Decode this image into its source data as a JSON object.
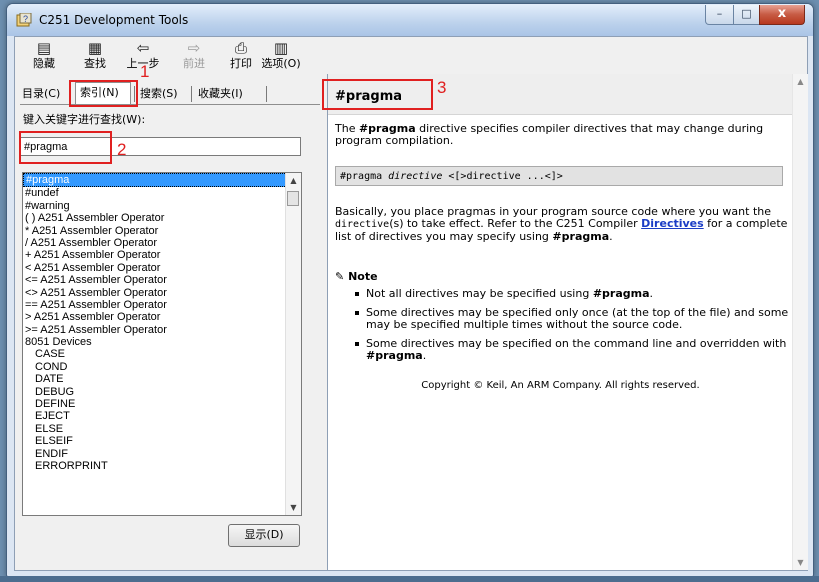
{
  "window": {
    "title": "C251 Development Tools",
    "controls": {
      "minimize": "–",
      "maximize": "□",
      "close": "x"
    }
  },
  "toolbar": [
    {
      "id": "hide",
      "label": "隐藏",
      "icon": "hide-icon",
      "glyph": "▤"
    },
    {
      "id": "find",
      "label": "查找",
      "icon": "find-icon",
      "glyph": "▦"
    },
    {
      "id": "back",
      "label": "上一步",
      "icon": "back-arrow-icon",
      "glyph": "⇦"
    },
    {
      "id": "forward",
      "label": "前进",
      "icon": "forward-arrow-icon",
      "glyph": "⇨"
    },
    {
      "id": "print",
      "label": "打印",
      "icon": "print-icon",
      "glyph": "⎙"
    },
    {
      "id": "options",
      "label": "选项(O)",
      "icon": "options-icon",
      "glyph": "▥"
    }
  ],
  "tabs": [
    {
      "label": "目录(C)",
      "active": false
    },
    {
      "label": "索引(N)",
      "active": true
    },
    {
      "label": "搜索(S)",
      "active": false
    },
    {
      "label": "收藏夹(I)",
      "active": false
    }
  ],
  "index": {
    "prompt": "键入关键字进行查找(W):",
    "keyword": "#pragma",
    "items": [
      {
        "text": "#pragma",
        "selected": true,
        "sub": false
      },
      {
        "text": "#undef",
        "selected": false,
        "sub": false
      },
      {
        "text": "#warning",
        "selected": false,
        "sub": false
      },
      {
        "text": "( ) A251 Assembler Operator",
        "selected": false,
        "sub": false
      },
      {
        "text": "* A251 Assembler Operator",
        "selected": false,
        "sub": false
      },
      {
        "text": "/ A251 Assembler Operator",
        "selected": false,
        "sub": false
      },
      {
        "text": "+ A251 Assembler Operator",
        "selected": false,
        "sub": false
      },
      {
        "text": "< A251 Assembler Operator",
        "selected": false,
        "sub": false
      },
      {
        "text": "<= A251 Assembler Operator",
        "selected": false,
        "sub": false
      },
      {
        "text": "<> A251 Assembler Operator",
        "selected": false,
        "sub": false
      },
      {
        "text": "== A251 Assembler Operator",
        "selected": false,
        "sub": false
      },
      {
        "text": "> A251 Assembler Operator",
        "selected": false,
        "sub": false
      },
      {
        "text": ">= A251 Assembler Operator",
        "selected": false,
        "sub": false
      },
      {
        "text": "8051 Devices",
        "selected": false,
        "sub": false
      },
      {
        "text": "CASE",
        "selected": false,
        "sub": true
      },
      {
        "text": "COND",
        "selected": false,
        "sub": true
      },
      {
        "text": "DATE",
        "selected": false,
        "sub": true
      },
      {
        "text": "DEBUG",
        "selected": false,
        "sub": true
      },
      {
        "text": "DEFINE",
        "selected": false,
        "sub": true
      },
      {
        "text": "EJECT",
        "selected": false,
        "sub": true
      },
      {
        "text": "ELSE",
        "selected": false,
        "sub": true
      },
      {
        "text": "ELSEIF",
        "selected": false,
        "sub": true
      },
      {
        "text": "ENDIF",
        "selected": false,
        "sub": true
      },
      {
        "text": "ERRORPRINT",
        "selected": false,
        "sub": true
      }
    ],
    "display_button": "显示(D)"
  },
  "topic": {
    "title": "#pragma",
    "intro_pre": "The ",
    "intro_bold": "#pragma",
    "intro_post": " directive specifies compiler directives that may change during program compilation.",
    "syntax_pre": "#pragma ",
    "syntax_italic": "directive",
    "syntax_post": " <[>directive ...<]>",
    "body_1": "Basically, you place pragmas in your program source code where you want the ",
    "body_code": "directive",
    "body_2": "(s) to take effect. Refer to the C251 Compiler ",
    "body_link": "Directives",
    "body_3": " for a complete list of directives you may specify using ",
    "body_bold": "#pragma",
    "body_4": ".",
    "note_title": "Note",
    "notes": [
      {
        "pre": "Not all directives may be specified using ",
        "bold": "#pragma",
        "post": "."
      },
      {
        "pre": "Some directives may be specified only once (at the top of the file) and some may be specified multiple times without the source code.",
        "bold": "",
        "post": ""
      },
      {
        "pre": "Some directives may be specified on the command line and overridden with ",
        "bold": "#pragma",
        "post": "."
      }
    ],
    "copyright": "Copyright © Keil, An ARM Company. All rights reserved."
  },
  "annotations": [
    {
      "label": "1"
    },
    {
      "label": "2"
    },
    {
      "label": "3"
    }
  ],
  "colors": {
    "highlight": "#e02020",
    "selection": "#3399ff",
    "link": "#1a3cc5"
  }
}
